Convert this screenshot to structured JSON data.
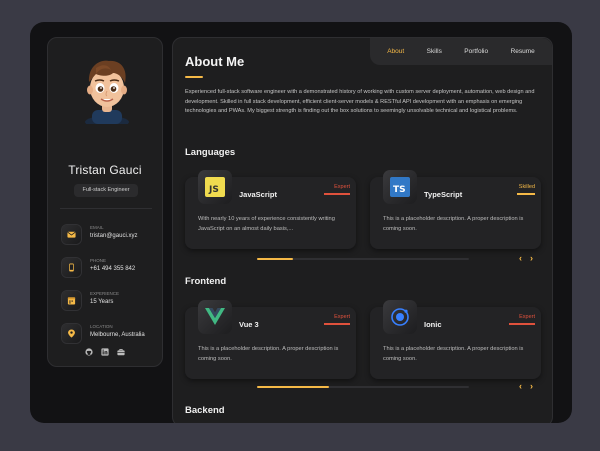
{
  "profile": {
    "name": "Tristan Gauci",
    "role": "Full-stack Engineer",
    "contacts": [
      {
        "label": "Email",
        "value": "tristan@gauci.xyz",
        "icon": "mail-icon"
      },
      {
        "label": "Phone",
        "value": "+61 494 355 842",
        "icon": "phone-icon"
      },
      {
        "label": "Experience",
        "value": "15 Years",
        "icon": "calendar-icon"
      },
      {
        "label": "Location",
        "value": "Melbourne, Australia",
        "icon": "location-pin-icon"
      }
    ],
    "social": [
      "github-icon",
      "linkedin-icon",
      "briefcase-icon"
    ]
  },
  "nav": {
    "items": [
      "About",
      "Skills",
      "Portfolio",
      "Resume"
    ],
    "active": "About"
  },
  "about": {
    "title": "About Me",
    "text": "Experienced full-stack software engineer with a demonstrated history of working with custom server deployment, automation, web design and development. Skilled in full stack development, efficient client-server models & RESTful API development with an emphasis on emerging technologies and PWAs. My biggest strength is finding out the box solutions to seemingly unsolvable technical and logistical problems."
  },
  "sections": [
    {
      "title": "Languages",
      "cards": [
        {
          "name": "JavaScript",
          "level": "Expert",
          "level_color": "#e0513c",
          "icon": "javascript-icon",
          "desc": "With nearly 10 years of experience consistently writing JavaScript on an almost daily basis,..."
        },
        {
          "name": "TypeScript",
          "level": "Skilled",
          "level_color": "#f5b947",
          "icon": "typescript-icon",
          "desc": "This is a placeholder description. A proper description is coming soon."
        }
      ],
      "scroll_progress": 0.17
    },
    {
      "title": "Frontend",
      "cards": [
        {
          "name": "Vue 3",
          "level": "Expert",
          "level_color": "#e0513c",
          "icon": "vue-icon",
          "desc": "This is a placeholder description. A proper description is coming soon."
        },
        {
          "name": "Ionic",
          "level": "Expert",
          "level_color": "#e0513c",
          "icon": "ionic-icon",
          "desc": "This is a placeholder description. A proper description is coming soon."
        }
      ],
      "scroll_progress": 0.34
    },
    {
      "title": "Backend",
      "cards": []
    }
  ],
  "colors": {
    "accent": "#f5b947",
    "expert": "#e0513c",
    "background": "#121214",
    "panel": "#1e1e1f"
  }
}
